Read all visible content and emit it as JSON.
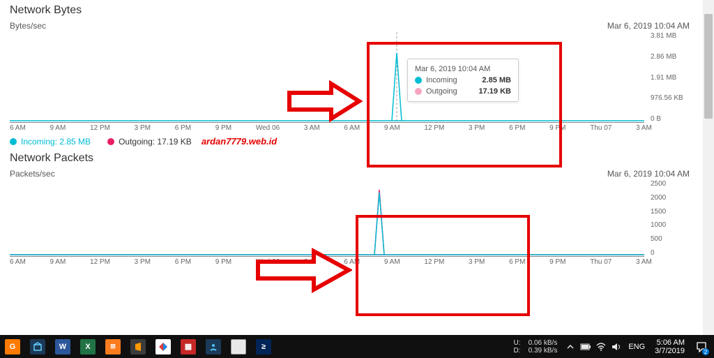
{
  "panel1": {
    "title": "Network Bytes",
    "ylabel": "Bytes/sec",
    "timestamp": "Mar 6, 2019 10:04 AM"
  },
  "panel2": {
    "title": "Network Packets",
    "ylabel": "Packets/sec",
    "timestamp": "Mar 6, 2019 10:04 AM"
  },
  "legend": {
    "incoming": "Incoming: 2.85 MB",
    "outgoing": "Outgoing: 17.19 KB"
  },
  "tooltip": {
    "time": "Mar 6, 2019 10:04 AM",
    "in_label": "Incoming",
    "in_value": "2.85 MB",
    "out_label": "Outgoing",
    "out_value": "17.19 KB"
  },
  "watermark": "ardan7779.web.id",
  "taskbar": {
    "net": {
      "u": "U:",
      "u_val": "0.06 kB/s",
      "d": "D:",
      "d_val": "0.39 kB/s"
    },
    "lang": "ENG",
    "time": "5:06 AM",
    "date": "3/7/2019",
    "notif_count": "2"
  },
  "chart_data": [
    {
      "type": "line",
      "title": "Network Bytes",
      "ylabel": "Bytes/sec",
      "xlabel": "",
      "ylim": [
        0,
        3810000
      ],
      "y_ticks_display": [
        "3.81 MB",
        "2.86 MB",
        "1.91 MB",
        "976.56 KB",
        "0 B"
      ],
      "x_ticks": [
        "6 AM",
        "9 AM",
        "12 PM",
        "3 PM",
        "6 PM",
        "9 PM",
        "Wed 06",
        "3 AM",
        "6 AM",
        "9 AM",
        "12 PM",
        "3 PM",
        "6 PM",
        "9 PM",
        "Thu 07",
        "3 AM"
      ],
      "series": [
        {
          "name": "Incoming",
          "color": "#00bcd4",
          "x": [
            "6 AM",
            "9 AM",
            "12 PM",
            "3 PM",
            "6 PM",
            "9 PM",
            "Wed 06",
            "3 AM",
            "6 AM",
            "9 AM",
            "10:04 AM",
            "12 PM",
            "3 PM",
            "6 PM",
            "9 PM",
            "Thu 07",
            "3 AM"
          ],
          "values": [
            0,
            0,
            0,
            0,
            0,
            0,
            0,
            0,
            0,
            0,
            2850000,
            0,
            0,
            0,
            0,
            0,
            0
          ]
        },
        {
          "name": "Outgoing",
          "color": "#e91e63",
          "x": [
            "6 AM",
            "9 AM",
            "12 PM",
            "3 PM",
            "6 PM",
            "9 PM",
            "Wed 06",
            "3 AM",
            "6 AM",
            "9 AM",
            "10:04 AM",
            "12 PM",
            "3 PM",
            "6 PM",
            "9 PM",
            "Thu 07",
            "3 AM"
          ],
          "values": [
            0,
            0,
            0,
            0,
            0,
            0,
            0,
            0,
            0,
            0,
            17190,
            0,
            0,
            0,
            0,
            0,
            0
          ]
        }
      ],
      "hover_point": {
        "x": "Mar 6, 2019 10:04 AM",
        "Incoming": "2.85 MB",
        "Outgoing": "17.19 KB"
      }
    },
    {
      "type": "line",
      "title": "Network Packets",
      "ylabel": "Packets/sec",
      "xlabel": "",
      "ylim": [
        0,
        2500
      ],
      "y_ticks_display": [
        "2500",
        "2000",
        "1500",
        "1000",
        "500",
        "0"
      ],
      "x_ticks": [
        "6 AM",
        "9 AM",
        "12 PM",
        "3 PM",
        "6 PM",
        "9 PM",
        "Wed 06",
        "3 AM",
        "6 AM",
        "9 AM",
        "12 PM",
        "3 PM",
        "6 PM",
        "9 PM",
        "Thu 07",
        "3 AM"
      ],
      "series": [
        {
          "name": "Incoming",
          "color": "#00bcd4",
          "x": [
            "6 AM",
            "9 AM",
            "12 PM",
            "3 PM",
            "6 PM",
            "9 PM",
            "Wed 06",
            "3 AM",
            "6 AM",
            "9 AM",
            "10:04 AM",
            "12 PM",
            "3 PM",
            "6 PM",
            "9 PM",
            "Thu 07",
            "3 AM"
          ],
          "values": [
            0,
            0,
            0,
            0,
            0,
            0,
            0,
            0,
            0,
            0,
            2100,
            0,
            0,
            0,
            0,
            0,
            0
          ]
        },
        {
          "name": "Outgoing",
          "color": "#e91e63",
          "x": [
            "6 AM",
            "9 AM",
            "12 PM",
            "3 PM",
            "6 PM",
            "9 PM",
            "Wed 06",
            "3 AM",
            "6 AM",
            "9 AM",
            "10:04 AM",
            "12 PM",
            "3 PM",
            "6 PM",
            "9 PM",
            "Thu 07",
            "3 AM"
          ],
          "values": [
            0,
            0,
            0,
            0,
            0,
            0,
            0,
            0,
            0,
            0,
            2150,
            0,
            0,
            0,
            0,
            0,
            0
          ]
        }
      ]
    }
  ]
}
